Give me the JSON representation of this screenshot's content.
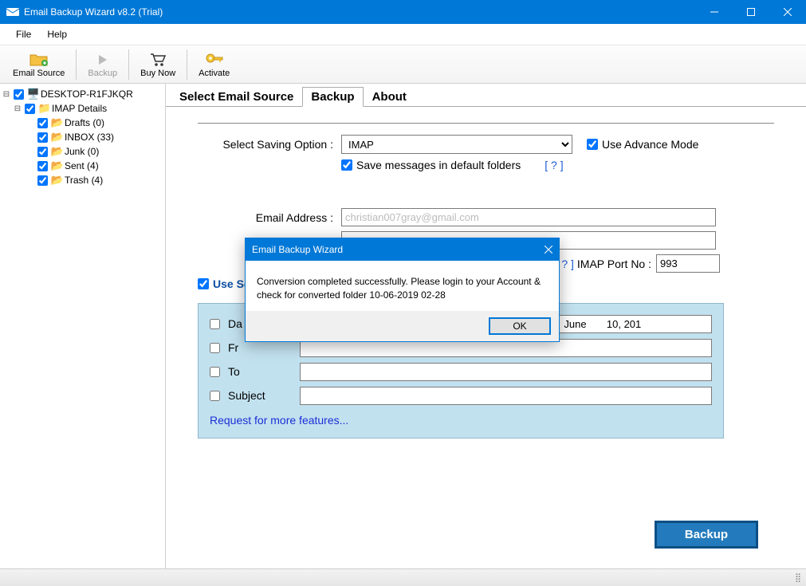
{
  "window": {
    "title": "Email Backup Wizard v8.2 (Trial)"
  },
  "menu": {
    "file": "File",
    "help": "Help"
  },
  "toolbar": {
    "email_source": "Email Source",
    "backup": "Backup",
    "buy_now": "Buy Now",
    "activate": "Activate"
  },
  "tree": {
    "root": "DESKTOP-R1FJKQR",
    "imap": "IMAP Details",
    "items": [
      {
        "label": "Drafts (0)"
      },
      {
        "label": "INBOX (33)"
      },
      {
        "label": "Junk (0)"
      },
      {
        "label": "Sent (4)"
      },
      {
        "label": "Trash (4)"
      }
    ]
  },
  "tabs": {
    "select": "Select Email Source",
    "backup": "Backup",
    "about": "About"
  },
  "form": {
    "saving_option_label": "Select Saving Option :",
    "saving_option_value": "IMAP",
    "use_advance": "Use Advance Mode",
    "save_default": "Save messages in default folders",
    "help": "[ ? ]",
    "email_label": "Email Address :",
    "email_value": "christian007gray@gmail.com",
    "port_label": "IMAP Port No :",
    "port_value": "993",
    "selective_label": "Use Selective",
    "date_filter": "Da",
    "date_value": "nday    ,      June       10, 201",
    "from_filter": "Fr",
    "to_filter": "To",
    "subject_filter": "Subject",
    "more_features": "Request for more features..."
  },
  "backup_button": "Backup",
  "modal": {
    "title": "Email Backup Wizard",
    "message": "Conversion completed successfully. Please login to your Account & check for converted folder 10-06-2019 02-28",
    "ok": "OK"
  }
}
